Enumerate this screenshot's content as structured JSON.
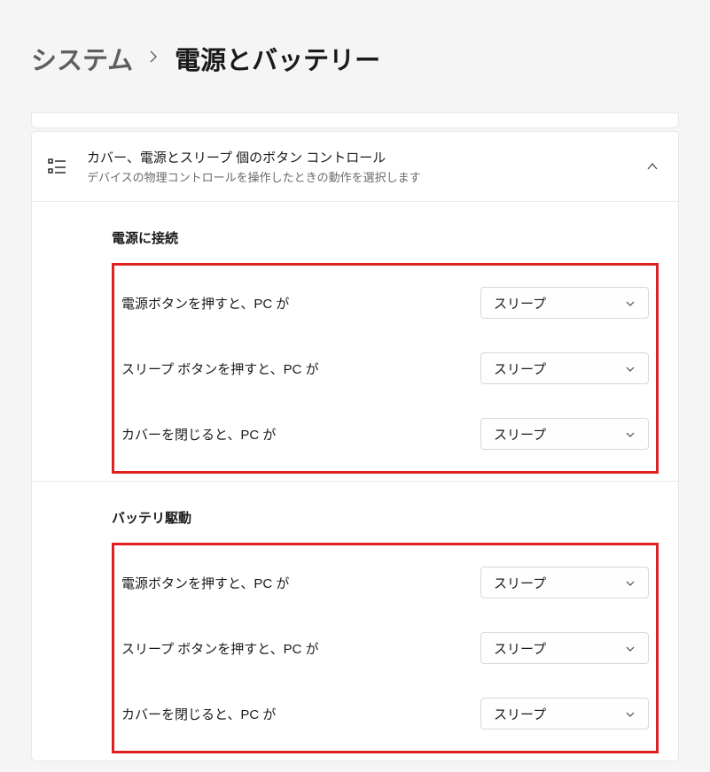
{
  "breadcrumb": {
    "parent": "システム",
    "current": "電源とバッテリー"
  },
  "panel": {
    "title": "カバー、電源とスリープ 個のボタン コントロール",
    "subtitle": "デバイスの物理コントロールを操作したときの動作を選択します"
  },
  "sections": {
    "plugged": {
      "title": "電源に接続",
      "rows": [
        {
          "label": "電源ボタンを押すと、PC が",
          "value": "スリープ"
        },
        {
          "label": "スリープ ボタンを押すと、PC が",
          "value": "スリープ"
        },
        {
          "label": "カバーを閉じると、PC が",
          "value": "スリープ"
        }
      ]
    },
    "battery": {
      "title": "バッテリ駆動",
      "rows": [
        {
          "label": "電源ボタンを押すと、PC が",
          "value": "スリープ"
        },
        {
          "label": "スリープ ボタンを押すと、PC が",
          "value": "スリープ"
        },
        {
          "label": "カバーを閉じると、PC が",
          "value": "スリープ"
        }
      ]
    }
  }
}
